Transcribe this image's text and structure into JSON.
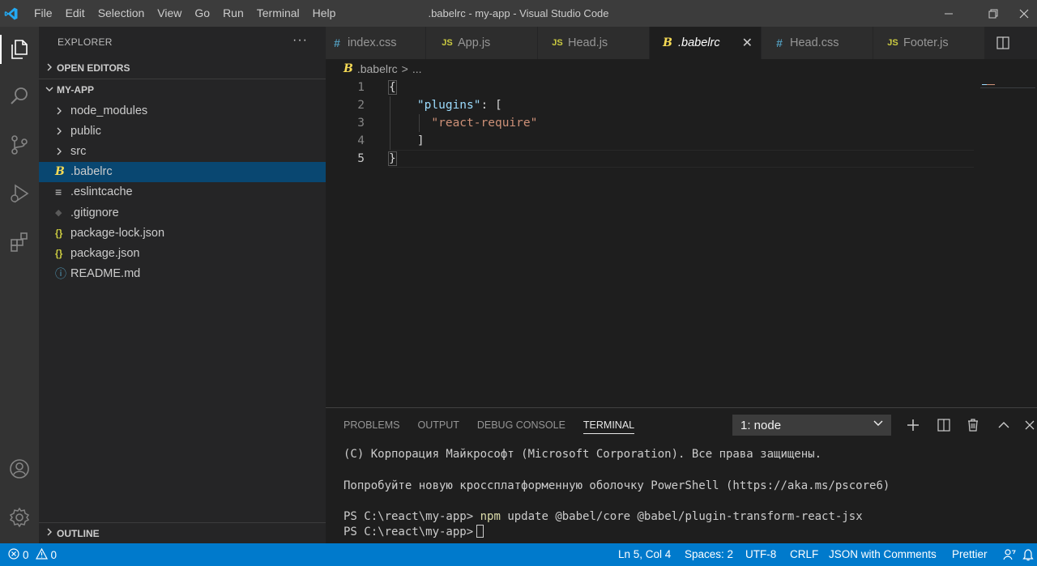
{
  "titlebar": {
    "menu": [
      "File",
      "Edit",
      "Selection",
      "View",
      "Go",
      "Run",
      "Terminal",
      "Help"
    ],
    "title": ".babelrc - my-app - Visual Studio Code"
  },
  "activity": {
    "icons": [
      "explorer-icon",
      "search-icon",
      "source-control-icon",
      "run-debug-icon",
      "extensions-icon",
      "account-icon",
      "settings-gear-icon"
    ]
  },
  "sidebar": {
    "title": "EXPLORER",
    "more": "···",
    "open_editors": "OPEN EDITORS",
    "project": "MY-APP",
    "items": [
      {
        "label": "node_modules",
        "icon": ">"
      },
      {
        "label": "public",
        "icon": ">"
      },
      {
        "label": "src",
        "icon": ">"
      },
      {
        "label": ".babelrc",
        "icon": "B"
      },
      {
        "label": ".eslintcache",
        "icon": "≡"
      },
      {
        "label": ".gitignore",
        "icon": "◆"
      },
      {
        "label": "package-lock.json",
        "icon": "{}"
      },
      {
        "label": "package.json",
        "icon": "{}"
      },
      {
        "label": "README.md",
        "icon": "ⓘ"
      }
    ],
    "outline": "OUTLINE"
  },
  "tabs": [
    {
      "label": "index.css",
      "icon": "#"
    },
    {
      "label": "App.js",
      "icon": "JS"
    },
    {
      "label": "Head.js",
      "icon": "JS"
    },
    {
      "label": ".babelrc",
      "icon": "B",
      "close": "✕"
    },
    {
      "label": "Head.css",
      "icon": "#"
    },
    {
      "label": "Footer.js",
      "icon": "JS"
    }
  ],
  "breadcrumb": {
    "file": ".babelrc",
    "sep": ">",
    "more": "..."
  },
  "editor": {
    "line_numbers": [
      "1",
      "2",
      "3",
      "4",
      "5"
    ],
    "lines": {
      "l1": "{",
      "l2_key": "\"plugins\"",
      "l2_rest": ": [",
      "l3": "\"react-require\"",
      "l4": "]",
      "l5": "}"
    }
  },
  "panel": {
    "tabs": [
      "PROBLEMS",
      "OUTPUT",
      "DEBUG CONSOLE",
      "TERMINAL"
    ],
    "terminal_select": "1: node",
    "terminal": {
      "line1": "(C) Корпорация Майкрософт (Microsoft Corporation). Все права защищены.",
      "line2": "Попробуйте новую кроссплатформенную оболочку PowerShell (https://aka.ms/pscore6)",
      "prompt": "PS C:\\react\\my-app>",
      "cmd_npm": "npm",
      "cmd_rest": "update @babel/core @babel/plugin-transform-react-jsx"
    }
  },
  "status": {
    "errors": "0",
    "warnings": "0",
    "position": "Ln 5, Col 4",
    "spaces": "Spaces: 2",
    "encoding": "UTF-8",
    "eol": "CRLF",
    "language": "JSON with Comments",
    "formatter": "Prettier"
  },
  "colors": {
    "statusbar": "#007acc",
    "selection": "#094771",
    "json_key": "#9cdcfe",
    "json_string": "#ce9178",
    "npm": "#dcdcaa"
  }
}
